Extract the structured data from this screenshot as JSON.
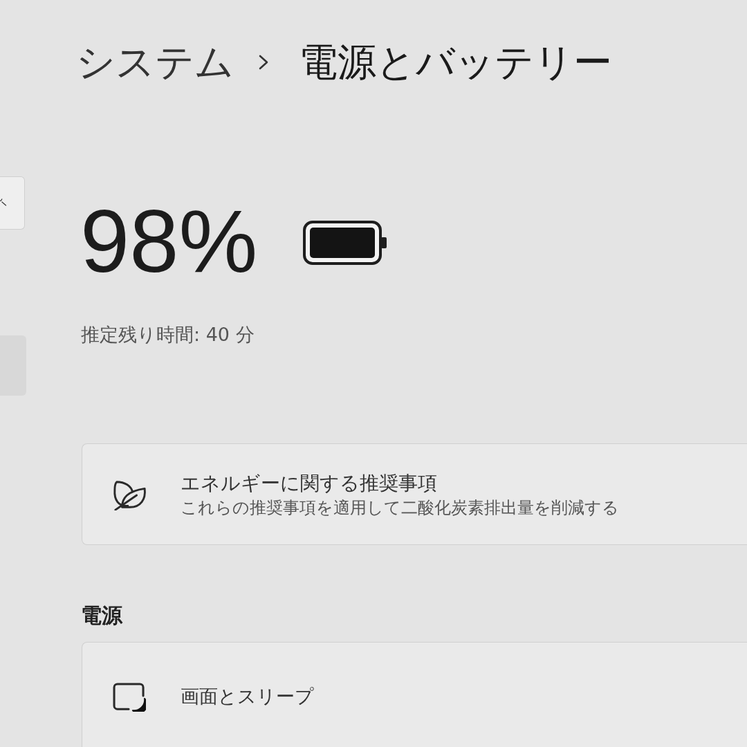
{
  "sidebar": {
    "items": [
      {
        "selected": true
      }
    ]
  },
  "breadcrumb": [
    "システム",
    "電源とバッテリー"
  ],
  "battery": {
    "percent": "98%",
    "estimate": "推定残り時間: 40 分"
  },
  "recommendation_card": {
    "title": "エネルギーに関する推奨事項",
    "description": "これらの推奨事項を適用して二酸化炭素排出量を削減する"
  },
  "sections": [
    {
      "heading": "電源",
      "items": [
        {
          "label": "画面とスリープ"
        }
      ]
    }
  ]
}
